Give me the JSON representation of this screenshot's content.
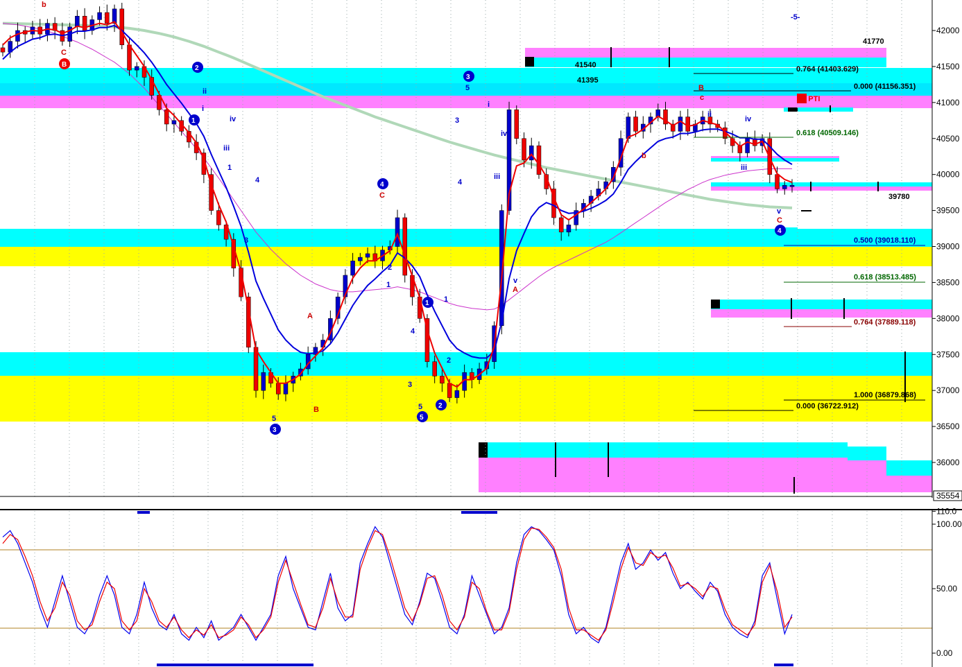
{
  "chart_data": [
    {
      "type": "candlestick",
      "panel": "price",
      "ylim": [
        35500,
        42350
      ],
      "y_ticks": [
        {
          "label": "42000",
          "value": 42000
        },
        {
          "label": "41500",
          "value": 41500
        },
        {
          "label": "41000",
          "value": 41000
        },
        {
          "label": "40500",
          "value": 40500
        },
        {
          "label": "40000",
          "value": 40000
        },
        {
          "label": "39500",
          "value": 39500
        },
        {
          "label": "39000",
          "value": 39000
        },
        {
          "label": "38500",
          "value": 38500
        },
        {
          "label": "38000",
          "value": 38000
        },
        {
          "label": "37500",
          "value": 37500
        },
        {
          "label": "37000",
          "value": 37000
        },
        {
          "label": "36500",
          "value": 36500
        },
        {
          "label": "36000",
          "value": 36000
        }
      ],
      "last_price_label": "35554",
      "close_series": [
        41700,
        41850,
        42000,
        41950,
        42050,
        41950,
        42100,
        42000,
        41850,
        42050,
        42200,
        42000,
        42150,
        42250,
        42100,
        42300,
        41800,
        41450,
        41500,
        41350,
        41100,
        40900,
        40700,
        40750,
        40600,
        40450,
        40300,
        40000,
        39500,
        39300,
        39100,
        38700,
        38300,
        37600,
        37000,
        37250,
        37100,
        36950,
        37100,
        37200,
        37300,
        37500,
        37600,
        37700,
        38000,
        38300,
        38600,
        38800,
        38850,
        38900,
        38800,
        38950,
        39000,
        39400,
        38600,
        38300,
        38000,
        37400,
        37200,
        37100,
        36900,
        37000,
        37250,
        37150,
        37300,
        37400,
        37900,
        39500,
        40900,
        40500,
        40200,
        40400,
        40000,
        39800,
        39400,
        39200,
        39300,
        39500,
        39600,
        39700,
        39800,
        39900,
        40100,
        40500,
        40800,
        40600,
        40700,
        40800,
        40900,
        40700,
        40600,
        40800,
        40600,
        40700,
        40800,
        40700,
        40650,
        40500,
        40400,
        40300,
        40500,
        40400,
        40500,
        40000,
        39800,
        39850,
        39850
      ],
      "ema_fast": [
        41800,
        41900,
        41950,
        41980,
        42000,
        41990,
        42020,
        42010,
        41960,
        42000,
        42060,
        42040,
        42070,
        42100,
        42080,
        42120,
        41980,
        41800,
        41650,
        41500,
        41320,
        41120,
        40920,
        40820,
        40700,
        40580,
        40440,
        40220,
        39860,
        39580,
        39340,
        39000,
        38650,
        38130,
        37570,
        37400,
        37250,
        37100,
        37100,
        37150,
        37230,
        37370,
        37480,
        37590,
        37800,
        38050,
        38330,
        38560,
        38700,
        38800,
        38800,
        38870,
        38940,
        39170,
        38880,
        38590,
        38290,
        37840,
        37520,
        37310,
        37100,
        37050,
        37150,
        37150,
        37220,
        37310,
        37610,
        38560,
        39730,
        40120,
        40160,
        40280,
        40140,
        39970,
        39680,
        39440,
        39370,
        39440,
        39520,
        39610,
        39700,
        39800,
        39950,
        40230,
        40520,
        40560,
        40630,
        40720,
        40810,
        40750,
        40680,
        40740,
        40670,
        40690,
        40750,
        40720,
        40690,
        40590,
        40490,
        40390,
        40450,
        40420,
        40460,
        40230,
        40010,
        39930,
        39890
      ],
      "ema_slow": [
        41600,
        41700,
        41780,
        41830,
        41880,
        41900,
        41940,
        41950,
        41930,
        41950,
        41990,
        41990,
        42010,
        42040,
        42040,
        42070,
        42000,
        41900,
        41800,
        41690,
        41560,
        41410,
        41250,
        41120,
        40990,
        40850,
        40710,
        40530,
        40280,
        40050,
        39820,
        39560,
        39280,
        38920,
        38520,
        38280,
        38060,
        37840,
        37700,
        37600,
        37530,
        37510,
        37520,
        37550,
        37650,
        37800,
        37990,
        38180,
        38330,
        38460,
        38550,
        38650,
        38740,
        38910,
        38840,
        38730,
        38580,
        38330,
        38100,
        37900,
        37700,
        37580,
        37520,
        37470,
        37450,
        37450,
        37550,
        37950,
        38550,
        38940,
        39180,
        39410,
        39540,
        39610,
        39570,
        39500,
        39460,
        39470,
        39490,
        39530,
        39580,
        39640,
        39730,
        39890,
        40070,
        40180,
        40280,
        40370,
        40460,
        40500,
        40520,
        40570,
        40570,
        40590,
        40620,
        40630,
        40630,
        40600,
        40560,
        40510,
        40510,
        40490,
        40490,
        40390,
        40280,
        40200,
        40140
      ],
      "ma_slow": [
        42100,
        42090,
        42080,
        42060,
        42040,
        42020,
        41990,
        41960,
        41920,
        41880,
        41840,
        41790,
        41740,
        41680,
        41620,
        41560,
        41480,
        41400,
        41300,
        41200,
        41080,
        40960,
        40840,
        40720,
        40600,
        40480,
        40360,
        40230,
        40090,
        39950,
        39800,
        39650,
        39500,
        39350,
        39200,
        39080,
        38960,
        38860,
        38760,
        38680,
        38600,
        38540,
        38480,
        38440,
        38400,
        38380,
        38370,
        38370,
        38380,
        38390,
        38400,
        38410,
        38420,
        38440,
        38420,
        38400,
        38370,
        38330,
        38290,
        38250,
        38210,
        38180,
        38160,
        38140,
        38130,
        38120,
        38130,
        38180,
        38260,
        38340,
        38420,
        38500,
        38580,
        38650,
        38710,
        38760,
        38810,
        38860,
        38910,
        38960,
        39010,
        39060,
        39120,
        39190,
        39260,
        39330,
        39400,
        39470,
        39540,
        39610,
        39670,
        39730,
        39790,
        39840,
        39890,
        39930,
        39960,
        39990,
        40010,
        40030,
        40050,
        40060,
        40070,
        40080,
        40080,
        40080,
        40080
      ],
      "ma_200": [
        42100,
        42098,
        42095,
        42092,
        42090,
        42088,
        42085,
        42082,
        42080,
        42077,
        42074,
        42070,
        42065,
        42060,
        42055,
        42050,
        42040,
        42030,
        42015,
        42000,
        41980,
        41960,
        41935,
        41910,
        41880,
        41850,
        41815,
        41780,
        41740,
        41700,
        41660,
        41620,
        41575,
        41530,
        41485,
        41440,
        41395,
        41350,
        41305,
        41260,
        41215,
        41170,
        41125,
        41080,
        41040,
        41000,
        40960,
        40920,
        40880,
        40840,
        40800,
        40765,
        40730,
        40695,
        40660,
        40625,
        40590,
        40555,
        40520,
        40485,
        40450,
        40420,
        40390,
        40360,
        40330,
        40300,
        40270,
        40245,
        40220,
        40195,
        40170,
        40145,
        40120,
        40095,
        40075,
        40055,
        40035,
        40015,
        39995,
        39975,
        39955,
        39935,
        39915,
        39895,
        39875,
        39855,
        39835,
        39815,
        39795,
        39775,
        39755,
        39735,
        39715,
        39695,
        39675,
        39655,
        39640,
        39625,
        39610,
        39595,
        39580,
        39570,
        39560,
        39550,
        39545,
        39540,
        39535
      ]
    },
    {
      "type": "line",
      "panel": "stochastic",
      "ylim": [
        0,
        110
      ],
      "y_ticks": [
        {
          "label": "110.0",
          "value": 110
        },
        {
          "label": "100.00",
          "value": 100
        },
        {
          "label": "50.00",
          "value": 50
        },
        {
          "label": "0.00",
          "value": 0
        }
      ],
      "overbought": 80,
      "oversold": 20,
      "series": [
        {
          "color": "#0000ee",
          "values": [
            90,
            95,
            85,
            70,
            55,
            35,
            20,
            40,
            60,
            40,
            20,
            15,
            25,
            45,
            60,
            45,
            20,
            15,
            30,
            55,
            35,
            22,
            18,
            30,
            15,
            10,
            20,
            12,
            25,
            10,
            15,
            20,
            30,
            20,
            10,
            20,
            30,
            60,
            75,
            50,
            35,
            20,
            18,
            40,
            62,
            35,
            25,
            30,
            70,
            85,
            98,
            90,
            70,
            50,
            30,
            22,
            40,
            62,
            58,
            40,
            20,
            15,
            30,
            60,
            45,
            30,
            15,
            20,
            35,
            70,
            92,
            98,
            95,
            88,
            80,
            60,
            30,
            15,
            20,
            12,
            8,
            20,
            45,
            70,
            85,
            65,
            70,
            80,
            72,
            78,
            62,
            50,
            55,
            48,
            42,
            55,
            48,
            30,
            20,
            15,
            12,
            25,
            60,
            70,
            42,
            15,
            30
          ]
        },
        {
          "color": "#ee0000",
          "values": [
            85,
            92,
            88,
            75,
            60,
            40,
            25,
            35,
            55,
            45,
            25,
            18,
            22,
            40,
            55,
            50,
            25,
            18,
            25,
            50,
            40,
            25,
            20,
            28,
            18,
            12,
            18,
            14,
            22,
            12,
            14,
            18,
            28,
            22,
            12,
            18,
            28,
            55,
            72,
            55,
            38,
            22,
            20,
            35,
            58,
            40,
            28,
            28,
            65,
            82,
            95,
            92,
            75,
            55,
            35,
            25,
            38,
            58,
            60,
            45,
            25,
            18,
            28,
            55,
            50,
            32,
            18,
            18,
            32,
            65,
            88,
            97,
            96,
            90,
            82,
            65,
            35,
            18,
            18,
            14,
            10,
            18,
            40,
            65,
            82,
            70,
            68,
            78,
            74,
            76,
            66,
            52,
            54,
            50,
            44,
            52,
            50,
            34,
            22,
            18,
            14,
            22,
            55,
            68,
            48,
            20,
            28
          ]
        }
      ]
    }
  ],
  "price_labels": {
    "l41770": "41770",
    "l41540": "41540",
    "l41395": "41395",
    "l39780": "39780",
    "top_marker": "-5-",
    "pti": "69 PTI"
  },
  "fib_labels": {
    "f1": "0.764 (41403.629)",
    "f2": "0.000 (41156.351)",
    "f3": "0.618 (40509.146)",
    "f4": "0.500 (39018.110)",
    "f5": "0.618 (38513.485)",
    "f6": "0.764 (37889.118)",
    "f7": "1.000 (36879.868)",
    "f8": "0.000 (36722.912)"
  },
  "wave_labels": {
    "c_top": "C",
    "b_top": "B",
    "b_small": "b",
    "b_red": "b",
    "a1": "A",
    "b1": "B",
    "c1": "C",
    "a2": "A",
    "v1": "v",
    "v2": "v",
    "c2": "C",
    "c3": "c",
    "b2": "B",
    "w1": "1",
    "w2": "2",
    "w3": "3",
    "w4": "4",
    "w5": "5",
    "i1": "i",
    "ii1": "ii",
    "iii1": "iii",
    "iv1": "iv",
    "ii2": "ii",
    "iii2": "iii",
    "iv2": "iv",
    "i2": "i",
    "ii3": "ii",
    "iii3": "iii",
    "iv3": "iv",
    "n1": "1",
    "n2": "2",
    "n3": "3",
    "n4": "4",
    "n5": "5",
    "n1b": "1",
    "n2b": "2",
    "n3b": "3",
    "n4b": "4",
    "n5b": "5",
    "n3c": "3",
    "n4c": "4",
    "n5c": "5",
    "n1c": "1",
    "n2c": "2",
    "circ1": "1",
    "circ2": "2",
    "circ3": "3",
    "circ4": "4",
    "circ5": "5",
    "circ1b": "1",
    "circ2b": "2",
    "circ3b": "3",
    "circ4b": "4",
    "circB": "B"
  },
  "colors": {
    "cyan": "#00ffff",
    "magenta": "#ff80ff",
    "yellow": "#ffff00",
    "up_candle": "#0000cc",
    "down_candle": "#ee0000",
    "ema_fast": "#ee0000",
    "ema_slow": "#0000dd",
    "ma_slow": "#cc33cc",
    "ma_200": "#b0d8b8",
    "fib_black": "#000000",
    "fib_green": "#006600",
    "fib_blue": "#0000aa",
    "fib_red": "#880000"
  }
}
